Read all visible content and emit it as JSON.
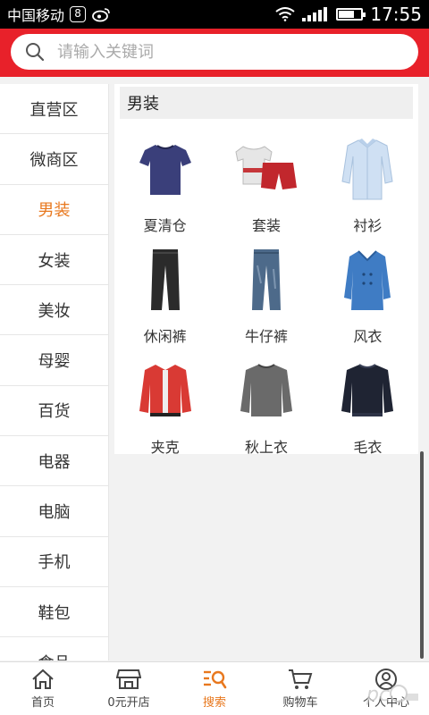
{
  "status_bar": {
    "carrier": "中国移动",
    "badge": "8",
    "time": "17:55",
    "battery_level": 0.65
  },
  "search": {
    "placeholder": "请输入关键词"
  },
  "sidebar": {
    "items": [
      {
        "label": "直营区"
      },
      {
        "label": "微商区"
      },
      {
        "label": "男装",
        "active": true
      },
      {
        "label": "女装"
      },
      {
        "label": "美妆"
      },
      {
        "label": "母婴"
      },
      {
        "label": "百货"
      },
      {
        "label": "电器"
      },
      {
        "label": "电脑"
      },
      {
        "label": "手机"
      },
      {
        "label": "鞋包"
      },
      {
        "label": "食品"
      }
    ]
  },
  "content": {
    "section_title": "男装",
    "products": [
      {
        "label": "夏清仓",
        "icon": "tshirt-icon"
      },
      {
        "label": "套装",
        "icon": "polo-shorts-set-icon"
      },
      {
        "label": "衬衫",
        "icon": "shirt-icon"
      },
      {
        "label": "休闲裤",
        "icon": "trousers-icon"
      },
      {
        "label": "牛仔裤",
        "icon": "jeans-icon"
      },
      {
        "label": "风衣",
        "icon": "trench-coat-icon"
      },
      {
        "label": "夹克",
        "icon": "jacket-icon"
      },
      {
        "label": "秋上衣",
        "icon": "sweater-icon"
      },
      {
        "label": "毛衣",
        "icon": "knit-sweater-icon"
      }
    ]
  },
  "bottom_nav": {
    "items": [
      {
        "label": "首页",
        "icon": "home-icon"
      },
      {
        "label": "0元开店",
        "icon": "store-icon"
      },
      {
        "label": "搜索",
        "icon": "search-list-icon",
        "active": true
      },
      {
        "label": "购物车",
        "icon": "cart-icon"
      },
      {
        "label": "个人中心",
        "icon": "user-icon"
      }
    ]
  },
  "colors": {
    "brand_red": "#e8212a",
    "active_orange": "#e8781e"
  }
}
